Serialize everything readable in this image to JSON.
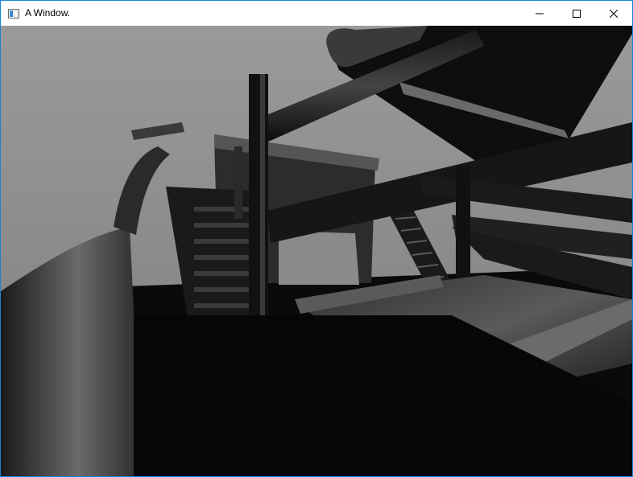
{
  "window": {
    "title": "A Window.",
    "icons": {
      "app": "app-window-icon",
      "minimize": "minimize-icon",
      "maximize": "maximize-icon",
      "close": "close-icon"
    }
  },
  "scene": {
    "description_type": "3d-render",
    "colors": {
      "sky": "#8c8c8c",
      "dark": "#080808"
    }
  }
}
